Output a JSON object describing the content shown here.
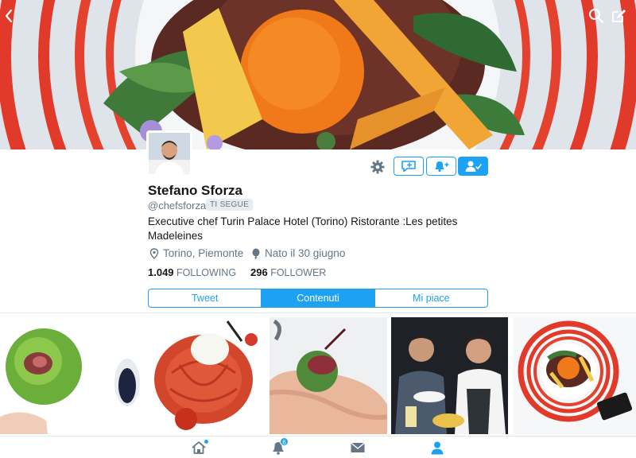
{
  "profile": {
    "name": "Stefano Sforza",
    "handle": "@chefsforza",
    "follows_you": "TI SEGUE",
    "bio": "Executive chef Turin Palace Hotel (Torino) Ristorante :Les petites Madeleines",
    "location": "Torino, Piemonte",
    "birthday": "Nato il 30 giugno",
    "following_count": "1.049",
    "following_label": "FOLLOWING",
    "followers_count": "296",
    "followers_label": "FOLLOWER"
  },
  "tabs": [
    {
      "label": "Tweet",
      "active": false
    },
    {
      "label": "Contenuti",
      "active": true
    },
    {
      "label": "Mi piace",
      "active": false
    }
  ],
  "bottom_nav": {
    "notifications_badge": "6"
  },
  "icons": {
    "back": "chevron-left-icon",
    "search": "search-icon",
    "compose": "compose-icon",
    "settings": "gear-icon",
    "message": "message-icon",
    "notify": "bell-plus-icon",
    "following": "user-check-icon",
    "location": "location-pin-icon",
    "birthday": "balloon-icon",
    "home": "home-icon",
    "notifications": "bell-icon",
    "messages": "envelope-icon",
    "me": "user-icon"
  },
  "colors": {
    "accent": "#1da1f2",
    "text": "#14171a",
    "muted": "#657786"
  }
}
